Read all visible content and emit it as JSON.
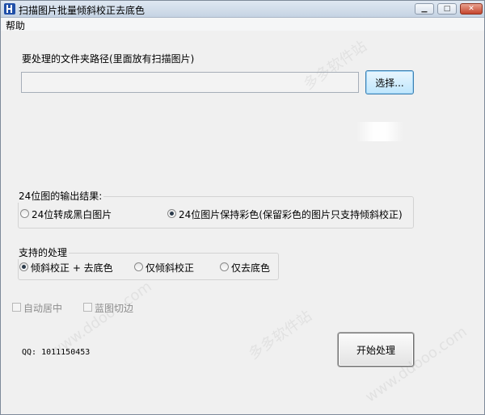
{
  "window": {
    "title": "扫描图片批量倾斜校正去底色",
    "controls": {
      "minimize": "▁",
      "maximize": "□",
      "close": "✕"
    }
  },
  "menu": {
    "items": [
      "帮助"
    ]
  },
  "folder": {
    "label": "要处理的文件夹路径(里面放有扫描图片)",
    "value": "",
    "select_button": "选择..."
  },
  "output_group": {
    "title": "24位图的输出结果:",
    "options": [
      {
        "label": "24位转成黑白图片",
        "checked": false
      },
      {
        "label": "24位图片保持彩色(保留彩色的图片只支持倾斜校正)",
        "checked": true
      }
    ]
  },
  "processing_group": {
    "title": "支持的处理",
    "options": [
      {
        "label": "倾斜校正 + 去底色",
        "checked": true
      },
      {
        "label": "仅倾斜校正",
        "checked": false
      },
      {
        "label": "仅去底色",
        "checked": false
      }
    ]
  },
  "checkboxes": [
    {
      "label": "自动居中",
      "checked": false,
      "enabled": false
    },
    {
      "label": "蓝图切边",
      "checked": false,
      "enabled": false
    }
  ],
  "qq": "QQ: 1011150453",
  "start_button": "开始处理",
  "watermarks": [
    "多多软件站",
    "www.ddooo.com",
    "多多软件站",
    "www.ddooo.com"
  ]
}
